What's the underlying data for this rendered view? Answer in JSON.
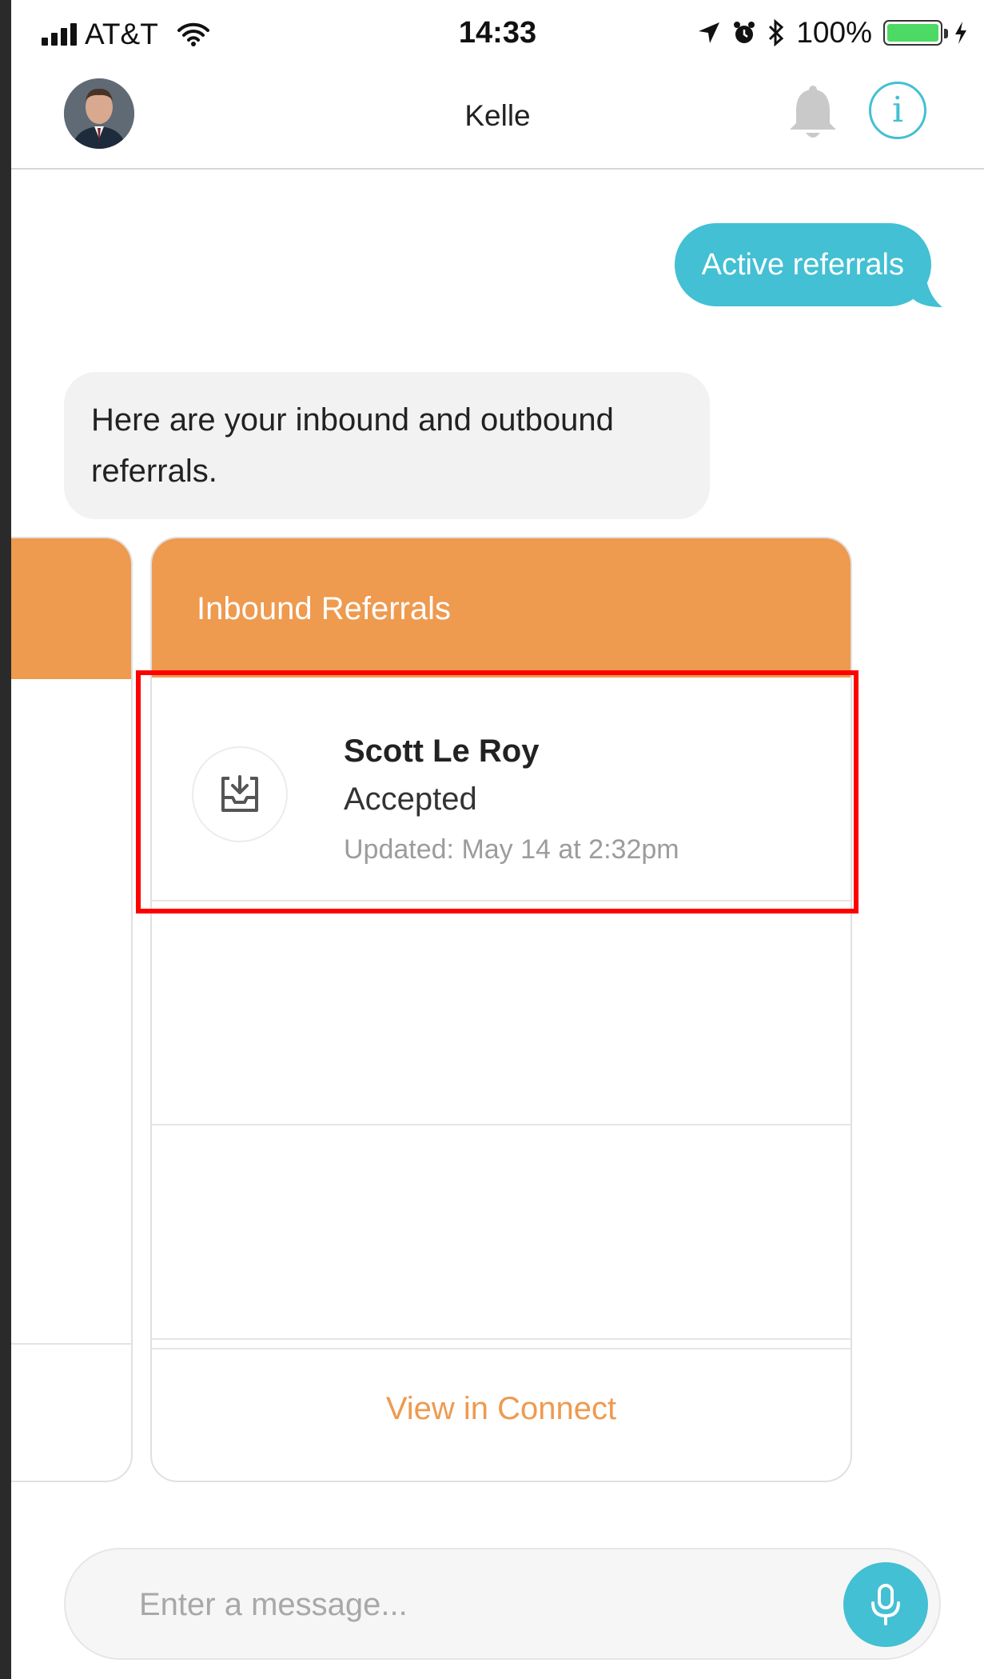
{
  "status_bar": {
    "carrier": "AT&T",
    "time": "14:33",
    "battery_percent": "100%",
    "battery_level": 1.0,
    "icons": [
      "signal-bars-icon",
      "wifi-icon",
      "location-arrow-icon",
      "alarm-clock-icon",
      "bluetooth-icon",
      "battery-icon",
      "charging-bolt-icon"
    ]
  },
  "header": {
    "title": "Kelle",
    "icons": [
      "avatar",
      "bell-icon",
      "info-icon"
    ],
    "info_glyph": "i"
  },
  "chat": {
    "outgoing_message": "Active referrals",
    "incoming_message": "Here are your inbound and outbound referrals."
  },
  "referral_card": {
    "header_title": "Inbound Referrals",
    "rows": [
      {
        "icon": "inbox-download-icon",
        "name": "Scott Le Roy",
        "status": "Accepted",
        "updated": "Updated: May 14 at 2:32pm"
      }
    ],
    "footer_link": "View in Connect"
  },
  "composer": {
    "placeholder": "Enter a message...",
    "value": "",
    "mic_icon": "microphone-icon"
  },
  "colors": {
    "accent_teal": "#43c0d3",
    "card_orange": "#ee9a4f",
    "highlight_red": "#ff0000"
  }
}
